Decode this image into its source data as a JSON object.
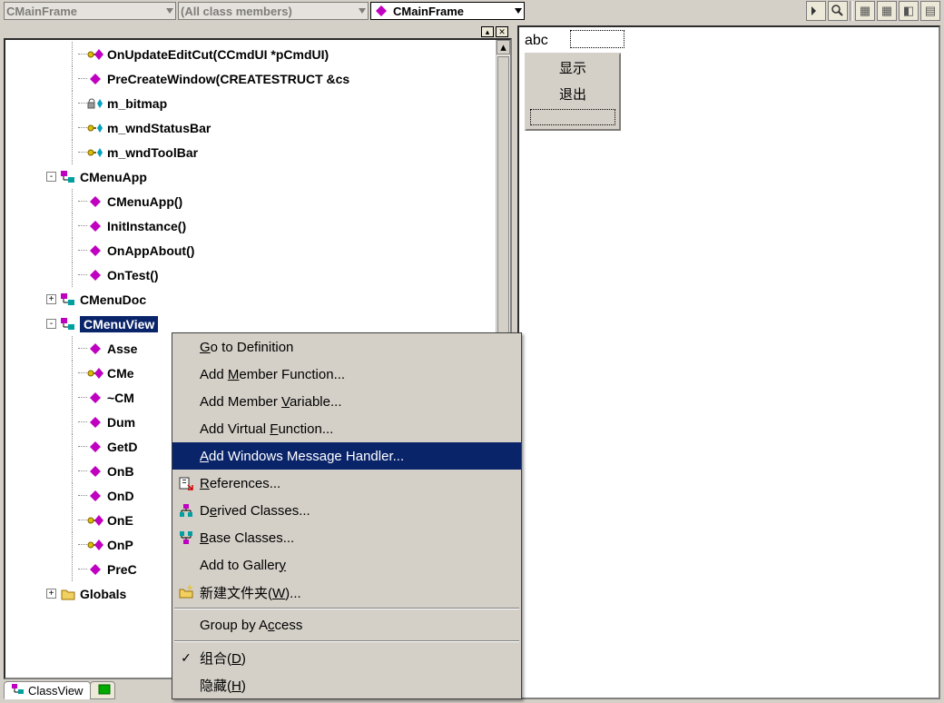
{
  "toolbar": {
    "combo1": "CMainFrame",
    "combo2": "(All class members)",
    "combo3": "CMainFrame"
  },
  "tree": {
    "items": [
      {
        "indent": 3,
        "icon": "method-key",
        "label": "OnUpdateEditCut(CCmdUI *pCmdUI)"
      },
      {
        "indent": 3,
        "icon": "method",
        "label": "PreCreateWindow(CREATESTRUCT &cs"
      },
      {
        "indent": 3,
        "icon": "var-lock",
        "label": "m_bitmap"
      },
      {
        "indent": 3,
        "icon": "var-key",
        "label": "m_wndStatusBar"
      },
      {
        "indent": 3,
        "icon": "var-key",
        "label": "m_wndToolBar"
      },
      {
        "indent": 2,
        "expander": "-",
        "icon": "class",
        "label": "CMenuApp"
      },
      {
        "indent": 3,
        "icon": "method",
        "label": "CMenuApp()"
      },
      {
        "indent": 3,
        "icon": "method",
        "label": "InitInstance()"
      },
      {
        "indent": 3,
        "icon": "method",
        "label": "OnAppAbout()"
      },
      {
        "indent": 3,
        "icon": "method",
        "label": "OnTest()"
      },
      {
        "indent": 2,
        "expander": "+",
        "icon": "class",
        "label": "CMenuDoc"
      },
      {
        "indent": 2,
        "expander": "-",
        "icon": "class",
        "label": "CMenuView",
        "selected": true
      },
      {
        "indent": 3,
        "icon": "method",
        "label": "Asse"
      },
      {
        "indent": 3,
        "icon": "method-key",
        "label": "CMe"
      },
      {
        "indent": 3,
        "icon": "method",
        "label": "~CM"
      },
      {
        "indent": 3,
        "icon": "method",
        "label": "Dum"
      },
      {
        "indent": 3,
        "icon": "method",
        "label": "GetD"
      },
      {
        "indent": 3,
        "icon": "method",
        "label": "OnB"
      },
      {
        "indent": 3,
        "icon": "method",
        "label": "OnD"
      },
      {
        "indent": 3,
        "icon": "method-key",
        "label": "OnE"
      },
      {
        "indent": 3,
        "icon": "method-key",
        "label": "OnP"
      },
      {
        "indent": 3,
        "icon": "method",
        "label": "PreC"
      },
      {
        "indent": 2,
        "expander": "+",
        "icon": "folder",
        "label": "Globals"
      }
    ],
    "tab": "ClassView"
  },
  "context_menu": {
    "items": [
      {
        "text_pre": "",
        "mnemonic": "G",
        "text_post": "o to Definition"
      },
      {
        "text_pre": "Add ",
        "mnemonic": "M",
        "text_post": "ember Function..."
      },
      {
        "text_pre": "Add Member ",
        "mnemonic": "V",
        "text_post": "ariable..."
      },
      {
        "text_pre": "Add Virtual ",
        "mnemonic": "F",
        "text_post": "unction..."
      },
      {
        "highlight": true,
        "text_pre": "",
        "mnemonic": "A",
        "text_post": "dd Windows Message Handler..."
      },
      {
        "icon": "refs",
        "text_pre": "",
        "mnemonic": "R",
        "text_post": "eferences..."
      },
      {
        "icon": "derived",
        "text_pre": "D",
        "mnemonic": "e",
        "text_post": "rived Classes..."
      },
      {
        "icon": "base",
        "text_pre": "",
        "mnemonic": "B",
        "text_post": "ase Classes..."
      },
      {
        "text_pre": "Add to Galler",
        "mnemonic": "y",
        "text_post": ""
      },
      {
        "icon": "newfolder",
        "text_pre": "新建文件夹(",
        "mnemonic": "W",
        "text_post": ")..."
      },
      {
        "sep": true
      },
      {
        "text_pre": "Group by A",
        "mnemonic": "c",
        "text_post": "cess"
      },
      {
        "sep": true
      },
      {
        "check": true,
        "text_pre": "组合(",
        "mnemonic": "D",
        "text_post": ")"
      },
      {
        "text_pre": "隐藏(",
        "mnemonic": "H",
        "text_post": ")"
      }
    ]
  },
  "preview": {
    "abc": "abc",
    "menu_items": [
      "显示",
      "退出"
    ]
  }
}
